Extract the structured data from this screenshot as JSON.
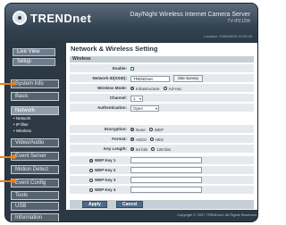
{
  "header": {
    "logo_text": "TRENDnet",
    "product_title": "Day/Night Wireless Internet Camera Server",
    "model": "TV-IP212W",
    "location_label": "Location",
    "location_value": "2009/08/10 12:00:00"
  },
  "sidebar": {
    "live_view": "Live View",
    "setup": "Setup",
    "items": [
      {
        "label": "System Info"
      },
      {
        "label": "Basic"
      },
      {
        "label": "Network"
      },
      {
        "label": "Video/Audio"
      },
      {
        "label": "Event Server"
      },
      {
        "label": "Motion Detect"
      },
      {
        "label": "Event Config"
      },
      {
        "label": "Tools"
      },
      {
        "label": "USB"
      },
      {
        "label": "Information"
      }
    ],
    "network_sub": [
      "• Network",
      "• IP filter",
      "• Wireless"
    ]
  },
  "content": {
    "title": "Network & Wireless Setting",
    "section": "Wireless",
    "enable_label": "Enable:",
    "ssid_label": "Network ID(SSID):",
    "ssid_value": "TRENDnet",
    "site_survey": "Site Survey",
    "mode_label": "Wireless Mode:",
    "mode_options": [
      "Infrastructure",
      "Ad-Hoc"
    ],
    "channel_label": "Channel:",
    "channel_value": "1",
    "auth_label": "Authentication:",
    "auth_value": "Open",
    "encryption_label": "Encryption:",
    "encryption_options": [
      "None",
      "WEP"
    ],
    "format_label": "Format:",
    "format_options": [
      "ASCII",
      "HEX"
    ],
    "keylen_label": "Key Length:",
    "keylen_options": [
      "64 bits",
      "128 bits"
    ],
    "wep_keys": [
      "WEP Key 1",
      "WEP Key 2",
      "WEP Key 3",
      "WEP Key 4"
    ],
    "apply": "Apply",
    "cancel": "Cancel"
  },
  "footer": "Copyright © 2007 TRENDnet. All Rights Reserved."
}
